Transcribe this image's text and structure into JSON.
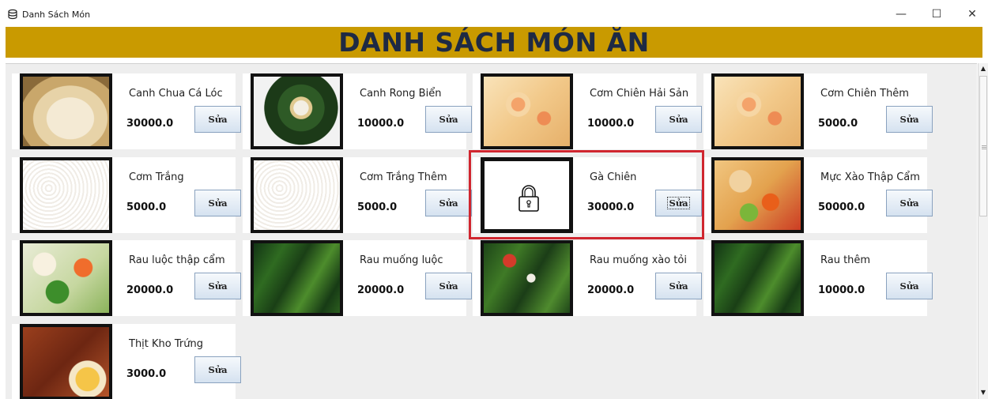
{
  "window": {
    "title": "Danh Sách Món",
    "controls": {
      "minimize": "—",
      "maximize": "☐",
      "close": "✕"
    }
  },
  "header": {
    "title": "DANH SÁCH MÓN ĂN"
  },
  "items": [
    {
      "name": "Canh Chua Cá Lóc",
      "price": "30000.0",
      "button": "Sửa",
      "image": "fish-soup-photo"
    },
    {
      "name": "Canh Rong Biển",
      "price": "10000.0",
      "button": "Sửa",
      "image": "seaweed-soup-photo"
    },
    {
      "name": "Cơm Chiên Hải Sản",
      "price": "10000.0",
      "button": "Sửa",
      "image": "seafood-fried-rice-photo"
    },
    {
      "name": "Cơm Chiên Thêm",
      "price": "5000.0",
      "button": "Sửa",
      "image": "seafood-fried-rice-photo"
    },
    {
      "name": "Cơm Trắng",
      "price": "5000.0",
      "button": "Sửa",
      "image": "white-rice-photo"
    },
    {
      "name": "Cơm Trắng Thêm",
      "price": "5000.0",
      "button": "Sửa",
      "image": "white-rice-photo"
    },
    {
      "name": "Gà Chiên",
      "price": "30000.0",
      "button": "Sửa",
      "image": "lock-icon",
      "selected": true
    },
    {
      "name": "Mực Xào Thập Cẩm",
      "price": "50000.0",
      "button": "Sửa",
      "image": "stir-fried-squid-photo"
    },
    {
      "name": "Rau luộc thập cẩm",
      "price": "20000.0",
      "button": "Sửa",
      "image": "boiled-vegetables-photo"
    },
    {
      "name": "Rau muống luộc",
      "price": "20000.0",
      "button": "Sửa",
      "image": "water-spinach-photo"
    },
    {
      "name": "Rau muống xào tỏi",
      "price": "20000.0",
      "button": "Sửa",
      "image": "water-spinach-garlic-photo"
    },
    {
      "name": "Rau thêm",
      "price": "10000.0",
      "button": "Sửa",
      "image": "water-spinach-photo"
    },
    {
      "name": "Thịt Kho Trứng",
      "price": "3000.0",
      "button": "Sửa",
      "image": "braised-pork-egg-photo"
    }
  ],
  "colors": {
    "header_bg": "#c99a00",
    "header_text": "#1e2a44",
    "selection_border": "#d0262f"
  }
}
